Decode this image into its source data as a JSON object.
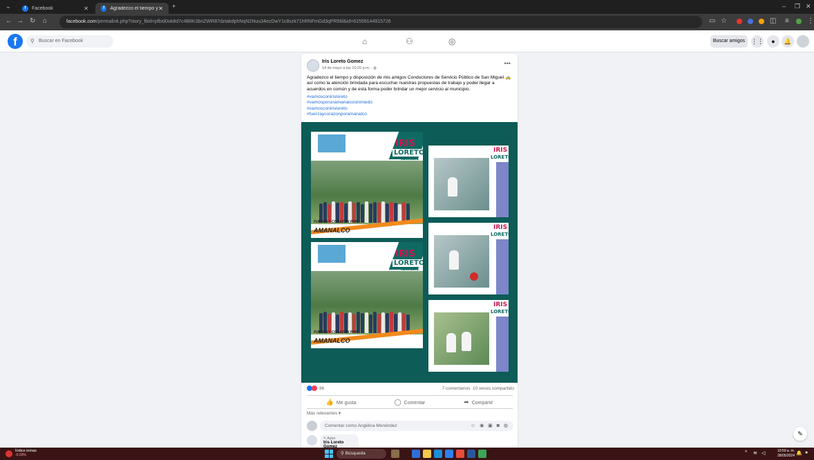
{
  "browser": {
    "tabs": [
      {
        "label": "Facebook",
        "active": false
      },
      {
        "label": "Agradezco el tiempo y dispos...",
        "active": true
      }
    ],
    "new_tab": "+",
    "url_domain": "facebook.com",
    "url_path": "/permalink.php?story_fbid=pfbid0ok8d7c4B8K3bnZWR87dztakdphNqN2Nuu34ezDwY1c8szk71hRNFmGd3qPR56l&id=61559144915726"
  },
  "facebook": {
    "search_placeholder": "Buscar en Facebook",
    "find_friends": "Buscar amigos"
  },
  "post": {
    "author": "Iris Loreto Gomez",
    "date": "14 de mayo a las 10:20 p.m.",
    "text": "Agradezco el tiempo y disposición de mis amigos Conductores de Servicio Público de San Miguel 🚕 así como la atención brindada para escuchar nuestras propuestas de trabajo y poder llegar a acuerdos en común y de esta forma poder brindar un mejor servicio al municipio.",
    "hashtags": [
      "#vamosconirisloreto",
      "#vamosporunamanalcosinmiedo",
      "#vamosconirisloreto",
      "#fuerzaycorazonporamanalco"
    ],
    "image_text": {
      "candidate_first": "IRIS",
      "candidate_last": "LORETO",
      "candidate_role": "CANDIDATA",
      "slogan": "FUERZA Y CORAZÓN POR",
      "town": "AMANALCO"
    },
    "reactions_count": "86",
    "comments_count": "7 comentarios",
    "shares_count": "10 veces compartido",
    "like_label": "Me gusta",
    "comment_label": "Comentar",
    "share_label": "Compartir",
    "sort_label": "Más relevantes",
    "comment_placeholder": "Comentar como Angélica Menéndez",
    "reply_badge": "Autor",
    "reply_author": "Iris Loreto Gomez"
  },
  "taskbar": {
    "widget_title": "Índice inmas",
    "widget_value": "-0.03%",
    "search_label": "Búsqueda",
    "time": "10:59 a. m.",
    "date": "28/05/2024"
  },
  "colors": {
    "facebook_blue": "#1877f2",
    "hashtag_blue": "#216fdb",
    "media_bg": "#0d5c57",
    "accent_orange": "#f28a1c",
    "candidate_pink": "#c7184f"
  }
}
